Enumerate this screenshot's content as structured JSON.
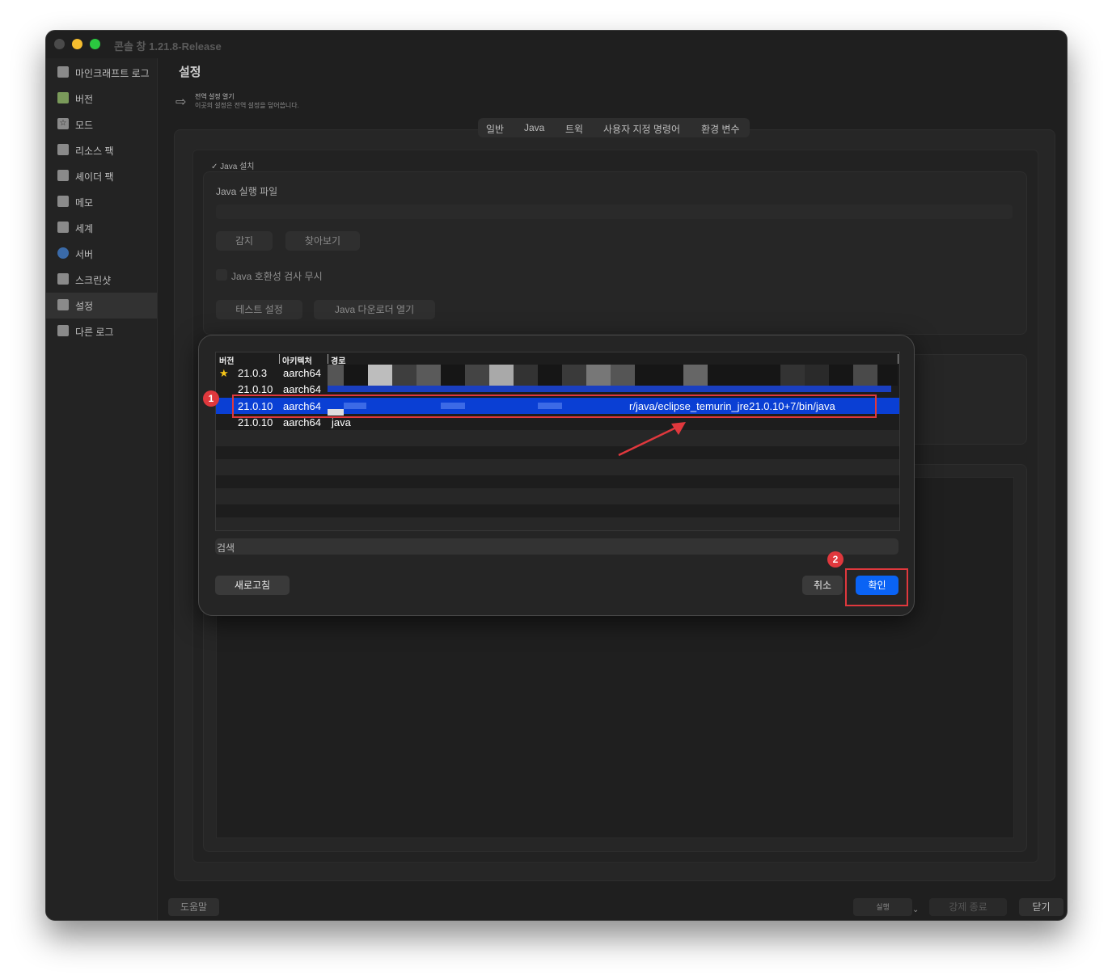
{
  "window": {
    "title": "콘솔 창 1.21.8-Release"
  },
  "sidebar": {
    "items": [
      {
        "label": "마인크래프트 로그",
        "icon": "book-icon"
      },
      {
        "label": "버전",
        "icon": "creeper-icon"
      },
      {
        "label": "모드",
        "icon": "puzzle-icon"
      },
      {
        "label": "리소스 팩",
        "icon": "chest-icon"
      },
      {
        "label": "셰이더 팩",
        "icon": "shader-icon"
      },
      {
        "label": "메모",
        "icon": "note-icon"
      },
      {
        "label": "세계",
        "icon": "world-icon"
      },
      {
        "label": "서버",
        "icon": "globe-icon"
      },
      {
        "label": "스크린샷",
        "icon": "image-icon"
      },
      {
        "label": "설정",
        "icon": "settings-icon",
        "active": true
      },
      {
        "label": "다른 로그",
        "icon": "book-icon"
      }
    ]
  },
  "main": {
    "title": "설정",
    "global_settings": {
      "title": "전역 설정 열기",
      "subtitle": "이곳의 설정은 전역 설정을 덮어씁니다."
    },
    "tabs": [
      "일반",
      "Java",
      "트윅",
      "사용자 지정 명령어",
      "환경 변수"
    ],
    "java_install": {
      "checkbox_label": "Java 설치",
      "executable_label": "Java 실행 파일",
      "detect_button": "감지",
      "browse_button": "찾아보기",
      "ignore_compat_label": "Java 호환성 검사 무시",
      "test_settings_button": "테스트 설정",
      "open_downloader_button": "Java 다운로더 열기"
    }
  },
  "footer": {
    "help": "도움말",
    "run": "실행",
    "force_quit": "강제 종료",
    "close": "닫기"
  },
  "dialog": {
    "columns": [
      "버전",
      "아키텍처",
      "경로"
    ],
    "rows": [
      {
        "version": "21.0.3",
        "arch": "aarch64",
        "path": "",
        "starred": true
      },
      {
        "version": "21.0.10",
        "arch": "aarch64",
        "path": ""
      },
      {
        "version": "21.0.10",
        "arch": "aarch64",
        "path": "r/java/eclipse_temurin_jre21.0.10+7/bin/java",
        "selected": true
      },
      {
        "version": "21.0.10",
        "arch": "aarch64",
        "path": "java"
      }
    ],
    "search_placeholder": "검색",
    "refresh_button": "새로고침",
    "cancel_button": "취소",
    "ok_button": "확인",
    "annotation_1": "1",
    "annotation_2": "2",
    "accent_color": "#0a63f5",
    "annotation_color": "#e0383d"
  }
}
